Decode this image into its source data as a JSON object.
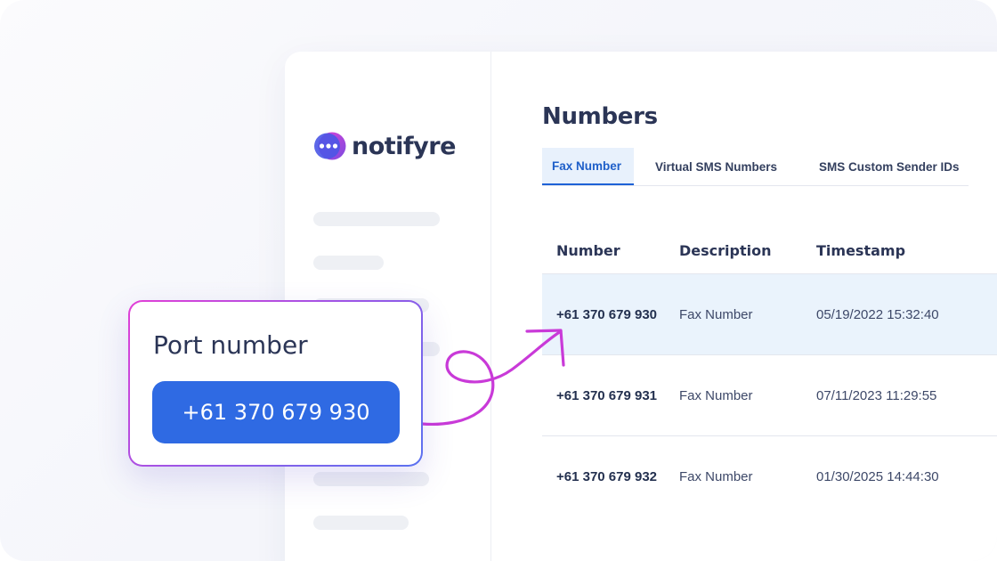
{
  "brand": {
    "name": "notifyre",
    "icon": "notifyre-logo-icon"
  },
  "main": {
    "title": "Numbers",
    "tabs": [
      {
        "label": "Fax Number",
        "active": true
      },
      {
        "label": "Virtual SMS Numbers",
        "active": false
      },
      {
        "label": "SMS Custom Sender IDs",
        "active": false
      }
    ]
  },
  "table": {
    "columns": [
      "Number",
      "Description",
      "Timestamp"
    ],
    "rows": [
      {
        "number": "+61 370 679 930",
        "description": "Fax Number",
        "timestamp": "05/19/2022 15:32:40",
        "highlighted": true
      },
      {
        "number": "+61 370 679 931",
        "description": "Fax Number",
        "timestamp": "07/11/2023 11:29:55",
        "highlighted": false
      },
      {
        "number": "+61 370 679 932",
        "description": "Fax Number",
        "timestamp": "01/30/2025 14:44:30",
        "highlighted": false
      }
    ]
  },
  "port_card": {
    "title": "Port number",
    "button_label": "+61 370 679 930"
  },
  "colors": {
    "accent_blue": "#2f6ae3",
    "brand_pink": "#e23fd6",
    "brand_purple": "#7a4ce0",
    "text_dark": "#2b3556",
    "highlight_row": "#eaf3fc"
  },
  "icons": {
    "arrow": "curly-arrow-icon"
  }
}
